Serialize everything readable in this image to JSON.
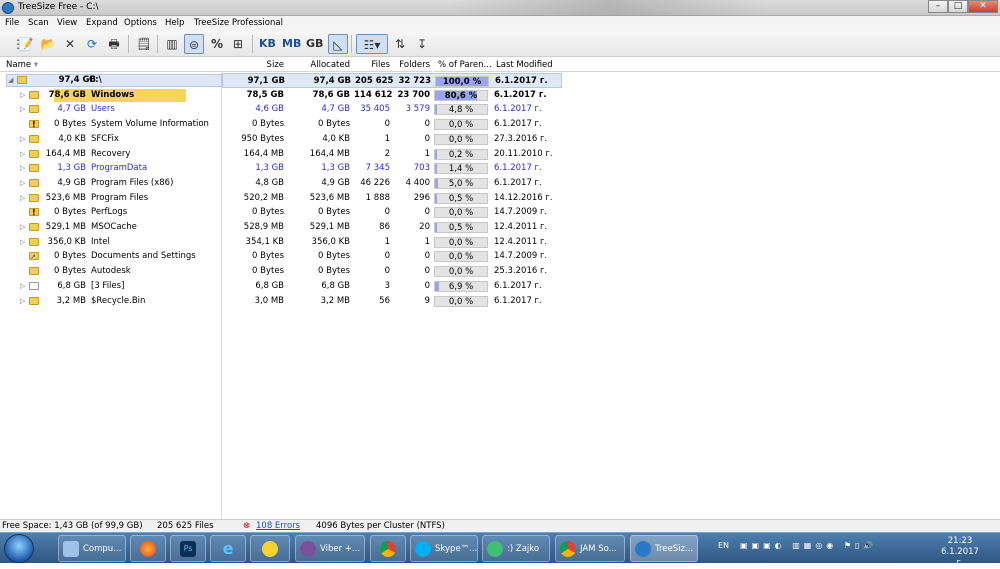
{
  "window": {
    "title": "TreeSize Free - C:\\"
  },
  "menu": [
    "File",
    "Scan",
    "View",
    "Expand",
    "Options",
    "Help",
    "TreeSize Professional"
  ],
  "toolbar": {
    "units": [
      "KB",
      "MB",
      "GB"
    ],
    "percent": "%"
  },
  "columns": {
    "name": "Name",
    "size": "Size",
    "allocated": "Allocated",
    "files": "Files",
    "folders": "Folders",
    "percent": "% of Paren...",
    "modified": "Last Modified"
  },
  "rows": [
    {
      "tsize": "97,4 GB",
      "name": "C:\\",
      "size": "97,1 GB",
      "alloc": "97,4 GB",
      "files": "205 625",
      "folders": "32 723",
      "pct": "100,0 %",
      "pctv": 100,
      "mod": "6.1.2017 г."
    },
    {
      "tsize": "78,6 GB",
      "name": "Windows",
      "size": "78,5 GB",
      "alloc": "78,6 GB",
      "files": "114 612",
      "folders": "23 700",
      "pct": "80,6 %",
      "pctv": 80.6,
      "mod": "6.1.2017 г."
    },
    {
      "tsize": "4,7 GB",
      "name": "Users",
      "size": "4,6 GB",
      "alloc": "4,7 GB",
      "files": "35 405",
      "folders": "3 579",
      "pct": "4,8 %",
      "pctv": 4.8,
      "mod": "6.1.2017 г."
    },
    {
      "tsize": "0 Bytes",
      "name": "System Volume Information",
      "size": "0 Bytes",
      "alloc": "0 Bytes",
      "files": "0",
      "folders": "0",
      "pct": "0,0 %",
      "pctv": 0,
      "mod": "6.1.2017 г."
    },
    {
      "tsize": "4,0 KB",
      "name": "SFCFix",
      "size": "950 Bytes",
      "alloc": "4,0 KB",
      "files": "1",
      "folders": "0",
      "pct": "0,0 %",
      "pctv": 0,
      "mod": "27.3.2016 г."
    },
    {
      "tsize": "164,4 MB",
      "name": "Recovery",
      "size": "164,4 MB",
      "alloc": "164,4 MB",
      "files": "2",
      "folders": "1",
      "pct": "0,2 %",
      "pctv": 0.2,
      "mod": "20.11.2010 г."
    },
    {
      "tsize": "1,3 GB",
      "name": "ProgramData",
      "size": "1,3 GB",
      "alloc": "1,3 GB",
      "files": "7 345",
      "folders": "703",
      "pct": "1,4 %",
      "pctv": 1.4,
      "mod": "6.1.2017 г."
    },
    {
      "tsize": "4,9 GB",
      "name": "Program Files (x86)",
      "size": "4,8 GB",
      "alloc": "4,9 GB",
      "files": "46 226",
      "folders": "4 400",
      "pct": "5,0 %",
      "pctv": 5.0,
      "mod": "6.1.2017 г."
    },
    {
      "tsize": "523,6 MB",
      "name": "Program Files",
      "size": "520,2 MB",
      "alloc": "523,6 MB",
      "files": "1 888",
      "folders": "296",
      "pct": "0,5 %",
      "pctv": 0.5,
      "mod": "14.12.2016 г."
    },
    {
      "tsize": "0 Bytes",
      "name": "PerfLogs",
      "size": "0 Bytes",
      "alloc": "0 Bytes",
      "files": "0",
      "folders": "0",
      "pct": "0,0 %",
      "pctv": 0,
      "mod": "14.7.2009 г."
    },
    {
      "tsize": "529,1 MB",
      "name": "MSOCache",
      "size": "528,9 MB",
      "alloc": "529,1 MB",
      "files": "86",
      "folders": "20",
      "pct": "0,5 %",
      "pctv": 0.5,
      "mod": "12.4.2011 г."
    },
    {
      "tsize": "356,0 KB",
      "name": "Intel",
      "size": "354,1 KB",
      "alloc": "356,0 KB",
      "files": "1",
      "folders": "1",
      "pct": "0,0 %",
      "pctv": 0,
      "mod": "12.4.2011 г."
    },
    {
      "tsize": "0 Bytes",
      "name": "Documents and Settings",
      "size": "0 Bytes",
      "alloc": "0 Bytes",
      "files": "0",
      "folders": "0",
      "pct": "0,0 %",
      "pctv": 0,
      "mod": "14.7.2009 г."
    },
    {
      "tsize": "0 Bytes",
      "name": "Autodesk",
      "size": "0 Bytes",
      "alloc": "0 Bytes",
      "files": "0",
      "folders": "0",
      "pct": "0,0 %",
      "pctv": 0,
      "mod": "25.3.2016 г."
    },
    {
      "tsize": "6,8 GB",
      "name": "[3 Files]",
      "size": "6,8 GB",
      "alloc": "6,8 GB",
      "files": "3",
      "folders": "0",
      "pct": "6,9 %",
      "pctv": 6.9,
      "mod": "6.1.2017 г."
    },
    {
      "tsize": "3,2 MB",
      "name": "$Recycle.Bin",
      "size": "3,0 MB",
      "alloc": "3,2 MB",
      "files": "56",
      "folders": "9",
      "pct": "0,0 %",
      "pctv": 0,
      "mod": "6.1.2017 г."
    }
  ],
  "status": {
    "free": "Free Space: 1,43 GB  (of 99,9 GB)",
    "files": "205 625  Files",
    "errors": "108 Errors",
    "cluster": "4096  Bytes per Cluster (NTFS)"
  },
  "taskbar": {
    "items": [
      "Compu...",
      "Viber +...",
      "Skype™...",
      ":) Zajko",
      "JAM So...",
      "TreeSiz..."
    ],
    "lang": "EN",
    "time": "21:23",
    "date": "6.1.2017 г."
  },
  "colors": {
    "accent": "#2a2ad4",
    "bar": "#9aa5f0",
    "selected": "#f6d55a"
  }
}
